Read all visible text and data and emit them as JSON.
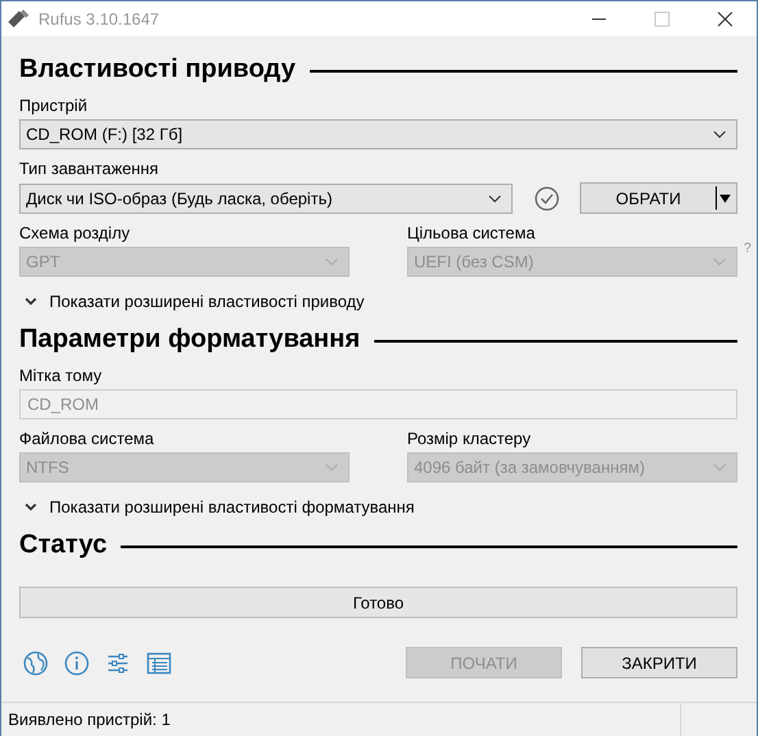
{
  "window": {
    "title": "Rufus 3.10.1647"
  },
  "sections": [
    {
      "title": "Властивості приводу",
      "rows": [
        {
          "kind": "select",
          "label": "Пристрій",
          "value": "CD_ROM (F:) [32 Гб]",
          "disabled": false
        },
        {
          "kind": "boot",
          "label": "Тип завантаження",
          "value": "Диск чи ISO-образ (Будь ласка, оберіть)",
          "button": "ОБРАТИ"
        },
        {
          "kind": "pair",
          "items": [
            {
              "label": "Схема розділу",
              "value": "GPT",
              "disabled": true
            },
            {
              "label": "Цільова система",
              "value": "UEFI (без CSM)",
              "disabled": true
            }
          ],
          "help": "?"
        },
        {
          "kind": "expander",
          "label": "Показати розширені властивості приводу",
          "expanded": false
        }
      ]
    },
    {
      "title": "Параметри форматування",
      "rows": [
        {
          "kind": "input",
          "label": "Мітка тому",
          "value": "CD_ROM",
          "disabled": true
        },
        {
          "kind": "pair",
          "items": [
            {
              "label": "Файлова система",
              "value": "NTFS",
              "disabled": true
            },
            {
              "label": "Розмір кластеру",
              "value": "4096 байт (за замовчуванням)",
              "disabled": true
            }
          ]
        },
        {
          "kind": "expander",
          "label": "Показати розширені властивості форматування",
          "expanded": false
        }
      ]
    },
    {
      "title": "Статус",
      "rows": [
        {
          "kind": "progress",
          "text": "Готово"
        }
      ]
    }
  ],
  "buttons": [
    {
      "label": "ПОЧАТИ",
      "disabled": true
    },
    {
      "label": "ЗАКРИТИ",
      "disabled": false
    }
  ],
  "status_bar": "Виявлено пристрій: 1"
}
